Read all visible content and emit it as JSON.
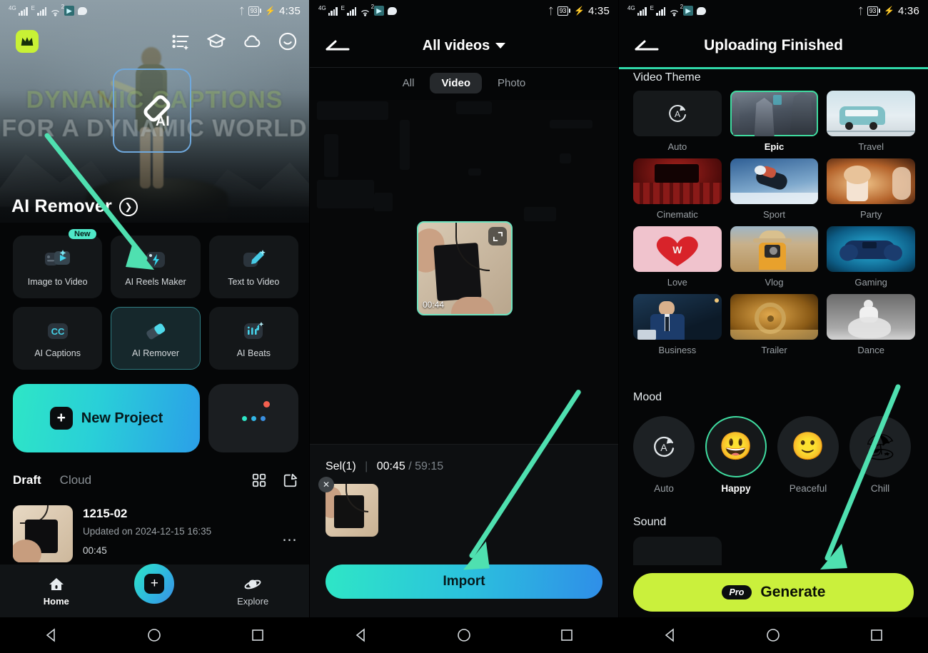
{
  "statusbars": [
    {
      "network": "4G",
      "network2": "E",
      "wifi_sup": "2",
      "battery": "93",
      "time": "4:35"
    },
    {
      "network": "4G",
      "network2": "E",
      "wifi_sup": "2",
      "battery": "93",
      "time": "4:35"
    },
    {
      "network": "4G",
      "network2": "E",
      "wifi_sup": "2",
      "battery": "93",
      "time": "4:36"
    }
  ],
  "panel1": {
    "hero": {
      "text_line1": "DYNAMIC CAPTIONS",
      "text_line2": "FOR A DYNAMIC WORLD",
      "badge_label": "AI",
      "feature_title": "AI Remover"
    },
    "top_icons": [
      "template-list-icon",
      "graduation-cap-icon",
      "cloud-icon",
      "smiley-icon"
    ],
    "crown_label": "crown-icon",
    "tools": [
      {
        "label": "Image to Video",
        "icon": "image-to-video-icon",
        "badge": "New",
        "selected": false
      },
      {
        "label": "AI Reels Maker",
        "icon": "reels-bolt-icon",
        "badge": "",
        "selected": false
      },
      {
        "label": "Text to Video",
        "icon": "text-to-video-pencil-icon",
        "badge": "",
        "selected": false
      },
      {
        "label": "AI Captions",
        "icon": "cc-icon",
        "badge": "",
        "selected": false
      },
      {
        "label": "AI Remover",
        "icon": "eraser-icon",
        "badge": "",
        "selected": true
      },
      {
        "label": "AI Beats",
        "icon": "music-beats-icon",
        "badge": "",
        "selected": false
      }
    ],
    "new_project_label": "New Project",
    "drafts": {
      "tab_draft": "Draft",
      "tab_cloud": "Cloud",
      "item": {
        "title": "1215-02",
        "updated": "Updated on 2024-12-15 16:35",
        "duration": "00:45"
      }
    },
    "bottom_nav": [
      {
        "label": "Home",
        "icon": "home-icon",
        "active": true
      },
      {
        "label": "Explore",
        "icon": "planet-icon",
        "active": false
      }
    ]
  },
  "panel2": {
    "title": "All videos",
    "segments": [
      {
        "label": "All",
        "active": false
      },
      {
        "label": "Video",
        "active": true
      },
      {
        "label": "Photo",
        "active": false
      }
    ],
    "video": {
      "duration": "00:44"
    },
    "selection": {
      "count_label": "Sel(1)",
      "selected_time": "00:45",
      "total_time": "59:15"
    },
    "import_label": "Import"
  },
  "panel3": {
    "title": "Uploading Finished",
    "section_theme": "Video Theme",
    "section_mood": "Mood",
    "section_sound": "Sound",
    "themes": [
      {
        "label": "Auto",
        "selected": false
      },
      {
        "label": "Epic",
        "selected": true
      },
      {
        "label": "Travel",
        "selected": false
      },
      {
        "label": "Cinematic",
        "selected": false
      },
      {
        "label": "Sport",
        "selected": false
      },
      {
        "label": "Party",
        "selected": false
      },
      {
        "label": "Love",
        "selected": false
      },
      {
        "label": "Vlog",
        "selected": false
      },
      {
        "label": "Gaming",
        "selected": false
      },
      {
        "label": "Business",
        "selected": false
      },
      {
        "label": "Trailer",
        "selected": false
      },
      {
        "label": "Dance",
        "selected": false
      }
    ],
    "moods": [
      {
        "label": "Auto",
        "emoji": "",
        "selected": false
      },
      {
        "label": "Happy",
        "emoji": "😃",
        "selected": true
      },
      {
        "label": "Peaceful",
        "emoji": "🙂",
        "selected": false
      },
      {
        "label": "Chill",
        "emoji": "🏖",
        "selected": false
      }
    ],
    "generate": {
      "badge": "Pro",
      "label": "Generate"
    }
  },
  "colors": {
    "accent_cyan": "#2ee6c6",
    "accent_green": "#3fdca0",
    "generate_green": "#caf03c",
    "arrow_green": "#4fe0b0",
    "crown_yellow": "#c8f135"
  }
}
